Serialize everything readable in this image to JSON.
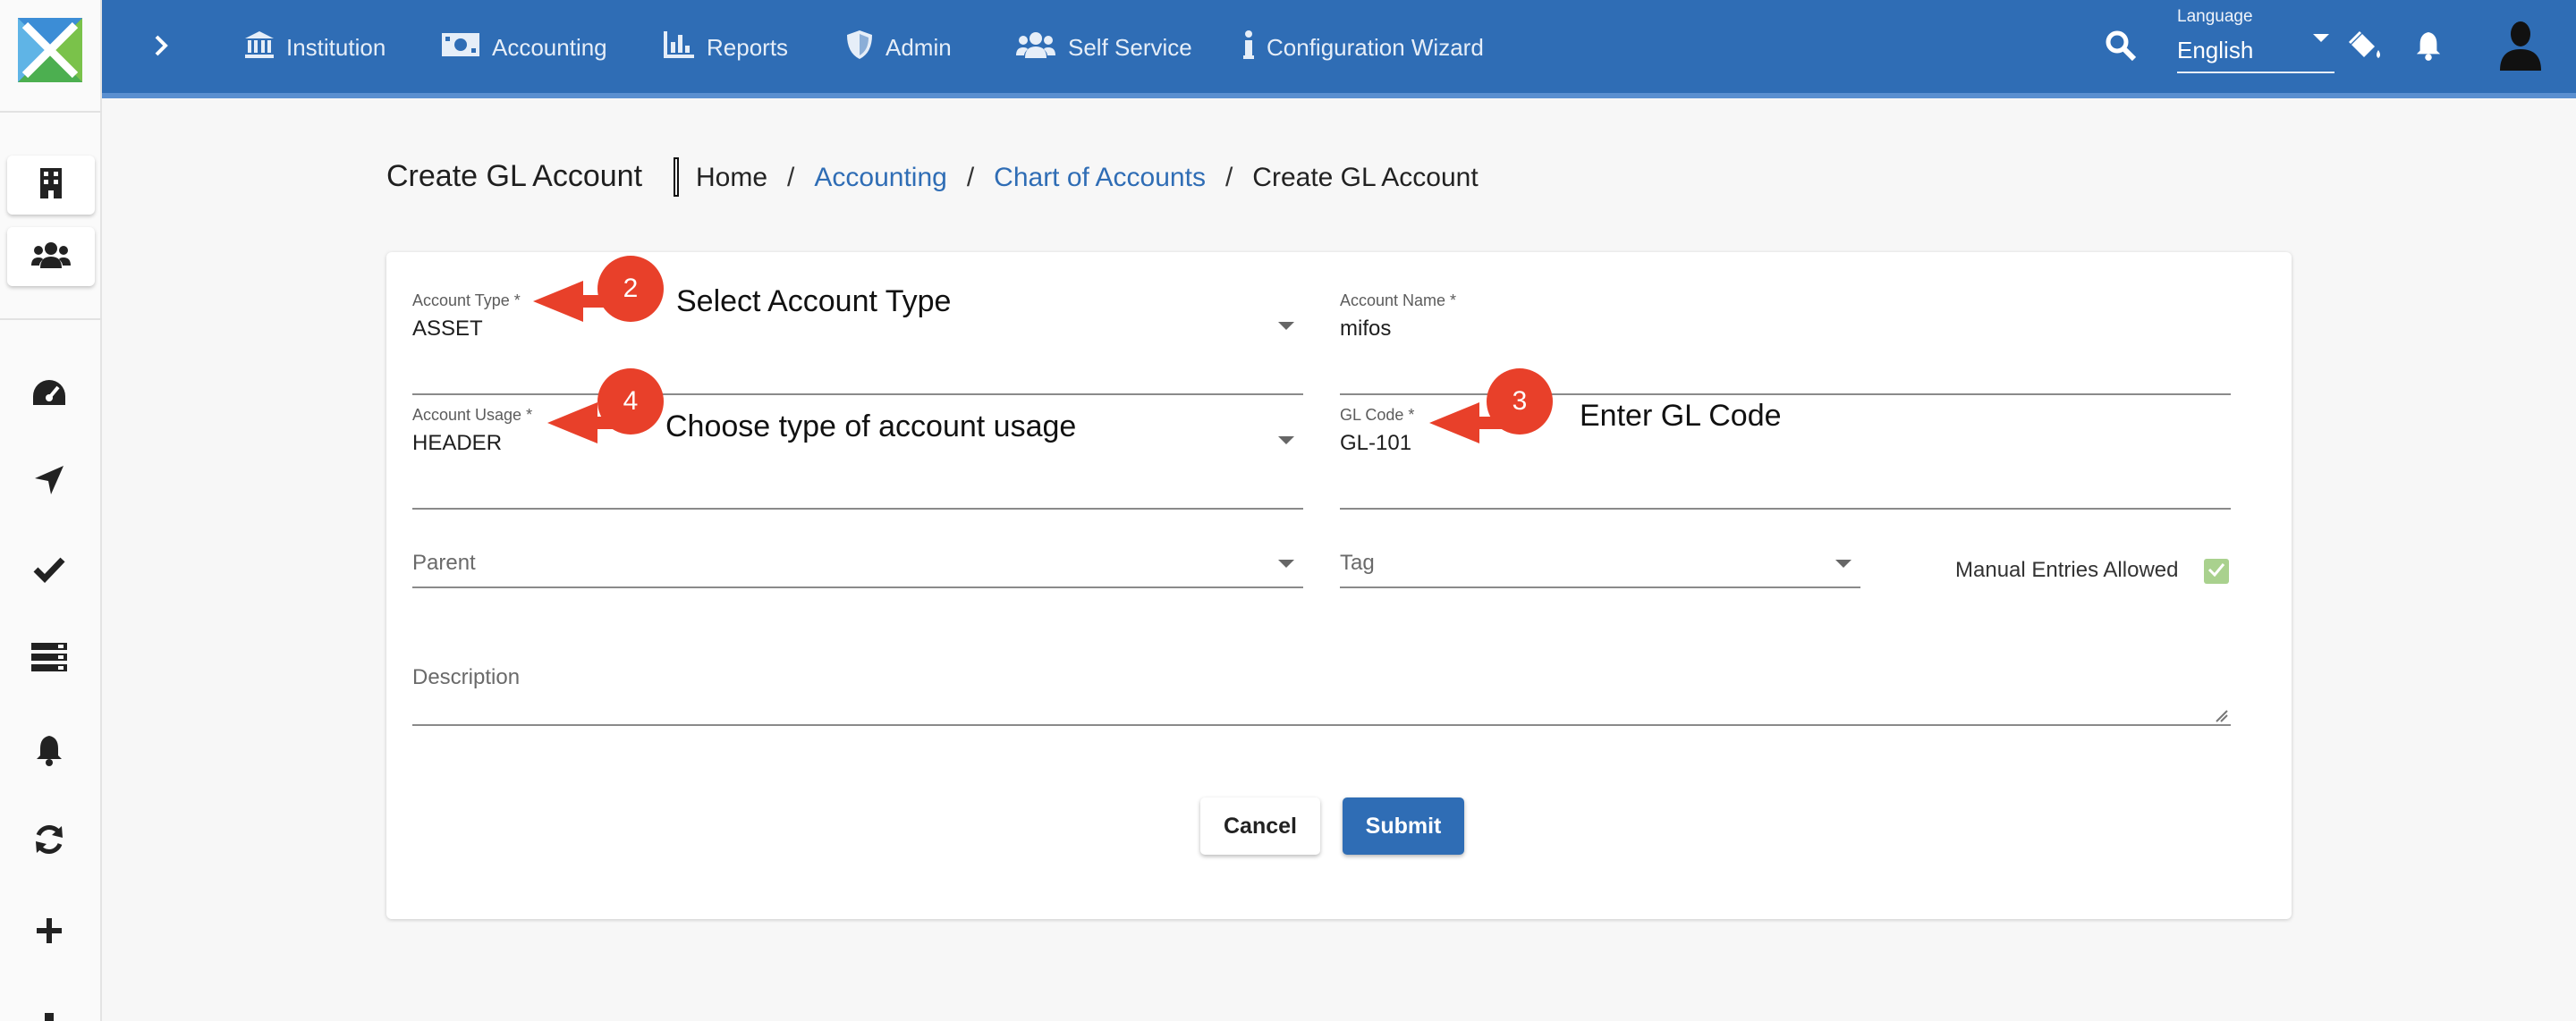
{
  "topbar": {
    "nav": [
      {
        "label": "Institution",
        "icon": "institution-icon"
      },
      {
        "label": "Accounting",
        "icon": "money-icon"
      },
      {
        "label": "Reports",
        "icon": "bar-chart-icon"
      },
      {
        "label": "Admin",
        "icon": "shield-icon"
      },
      {
        "label": "Self Service",
        "icon": "users-icon"
      },
      {
        "label": "Configuration Wizard",
        "icon": "info-icon"
      }
    ],
    "language_label": "Language",
    "language_value": "English"
  },
  "page": {
    "title": "Create GL Account",
    "breadcrumb": [
      "Home",
      "Accounting",
      "Chart of Accounts",
      "Create GL Account"
    ],
    "breadcrumb_sep": "/"
  },
  "form": {
    "account_type": {
      "label": "Account Type *",
      "value": "ASSET"
    },
    "account_name": {
      "label": "Account Name *",
      "value": "mifos"
    },
    "account_usage": {
      "label": "Account Usage *",
      "value": "HEADER"
    },
    "gl_code": {
      "label": "GL Code *",
      "value": "GL-101"
    },
    "parent": {
      "placeholder": "Parent"
    },
    "tag": {
      "placeholder": "Tag"
    },
    "manual_entries": {
      "label": "Manual Entries Allowed",
      "checked": true
    },
    "description": {
      "placeholder": "Description"
    },
    "cancel_label": "Cancel",
    "submit_label": "Submit"
  },
  "annotations": [
    {
      "number": "2",
      "text": "Select Account Type"
    },
    {
      "number": "3",
      "text": "Enter GL Code"
    },
    {
      "number": "4",
      "text": "Choose type of account usage"
    }
  ],
  "colors": {
    "primary": "#2f6db5",
    "annotation": "#e8402a",
    "checkbox": "#a9d18e"
  }
}
